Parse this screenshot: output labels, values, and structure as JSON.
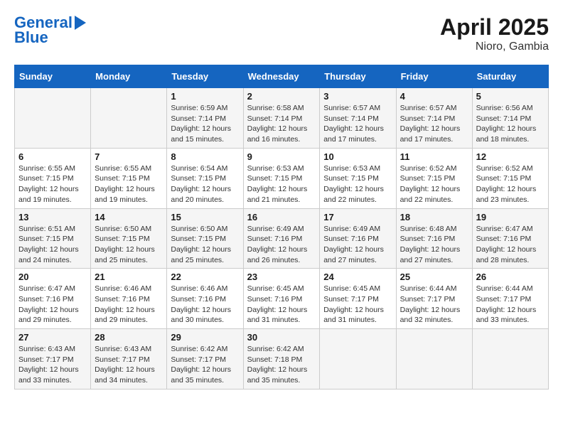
{
  "header": {
    "logo_line1": "General",
    "logo_line2": "Blue",
    "title": "April 2025",
    "subtitle": "Nioro, Gambia"
  },
  "days_of_week": [
    "Sunday",
    "Monday",
    "Tuesday",
    "Wednesday",
    "Thursday",
    "Friday",
    "Saturday"
  ],
  "weeks": [
    [
      {
        "day": "",
        "info": ""
      },
      {
        "day": "",
        "info": ""
      },
      {
        "day": "1",
        "info": "Sunrise: 6:59 AM\nSunset: 7:14 PM\nDaylight: 12 hours and 15 minutes."
      },
      {
        "day": "2",
        "info": "Sunrise: 6:58 AM\nSunset: 7:14 PM\nDaylight: 12 hours and 16 minutes."
      },
      {
        "day": "3",
        "info": "Sunrise: 6:57 AM\nSunset: 7:14 PM\nDaylight: 12 hours and 17 minutes."
      },
      {
        "day": "4",
        "info": "Sunrise: 6:57 AM\nSunset: 7:14 PM\nDaylight: 12 hours and 17 minutes."
      },
      {
        "day": "5",
        "info": "Sunrise: 6:56 AM\nSunset: 7:14 PM\nDaylight: 12 hours and 18 minutes."
      }
    ],
    [
      {
        "day": "6",
        "info": "Sunrise: 6:55 AM\nSunset: 7:15 PM\nDaylight: 12 hours and 19 minutes."
      },
      {
        "day": "7",
        "info": "Sunrise: 6:55 AM\nSunset: 7:15 PM\nDaylight: 12 hours and 19 minutes."
      },
      {
        "day": "8",
        "info": "Sunrise: 6:54 AM\nSunset: 7:15 PM\nDaylight: 12 hours and 20 minutes."
      },
      {
        "day": "9",
        "info": "Sunrise: 6:53 AM\nSunset: 7:15 PM\nDaylight: 12 hours and 21 minutes."
      },
      {
        "day": "10",
        "info": "Sunrise: 6:53 AM\nSunset: 7:15 PM\nDaylight: 12 hours and 22 minutes."
      },
      {
        "day": "11",
        "info": "Sunrise: 6:52 AM\nSunset: 7:15 PM\nDaylight: 12 hours and 22 minutes."
      },
      {
        "day": "12",
        "info": "Sunrise: 6:52 AM\nSunset: 7:15 PM\nDaylight: 12 hours and 23 minutes."
      }
    ],
    [
      {
        "day": "13",
        "info": "Sunrise: 6:51 AM\nSunset: 7:15 PM\nDaylight: 12 hours and 24 minutes."
      },
      {
        "day": "14",
        "info": "Sunrise: 6:50 AM\nSunset: 7:15 PM\nDaylight: 12 hours and 25 minutes."
      },
      {
        "day": "15",
        "info": "Sunrise: 6:50 AM\nSunset: 7:15 PM\nDaylight: 12 hours and 25 minutes."
      },
      {
        "day": "16",
        "info": "Sunrise: 6:49 AM\nSunset: 7:16 PM\nDaylight: 12 hours and 26 minutes."
      },
      {
        "day": "17",
        "info": "Sunrise: 6:49 AM\nSunset: 7:16 PM\nDaylight: 12 hours and 27 minutes."
      },
      {
        "day": "18",
        "info": "Sunrise: 6:48 AM\nSunset: 7:16 PM\nDaylight: 12 hours and 27 minutes."
      },
      {
        "day": "19",
        "info": "Sunrise: 6:47 AM\nSunset: 7:16 PM\nDaylight: 12 hours and 28 minutes."
      }
    ],
    [
      {
        "day": "20",
        "info": "Sunrise: 6:47 AM\nSunset: 7:16 PM\nDaylight: 12 hours and 29 minutes."
      },
      {
        "day": "21",
        "info": "Sunrise: 6:46 AM\nSunset: 7:16 PM\nDaylight: 12 hours and 29 minutes."
      },
      {
        "day": "22",
        "info": "Sunrise: 6:46 AM\nSunset: 7:16 PM\nDaylight: 12 hours and 30 minutes."
      },
      {
        "day": "23",
        "info": "Sunrise: 6:45 AM\nSunset: 7:16 PM\nDaylight: 12 hours and 31 minutes."
      },
      {
        "day": "24",
        "info": "Sunrise: 6:45 AM\nSunset: 7:17 PM\nDaylight: 12 hours and 31 minutes."
      },
      {
        "day": "25",
        "info": "Sunrise: 6:44 AM\nSunset: 7:17 PM\nDaylight: 12 hours and 32 minutes."
      },
      {
        "day": "26",
        "info": "Sunrise: 6:44 AM\nSunset: 7:17 PM\nDaylight: 12 hours and 33 minutes."
      }
    ],
    [
      {
        "day": "27",
        "info": "Sunrise: 6:43 AM\nSunset: 7:17 PM\nDaylight: 12 hours and 33 minutes."
      },
      {
        "day": "28",
        "info": "Sunrise: 6:43 AM\nSunset: 7:17 PM\nDaylight: 12 hours and 34 minutes."
      },
      {
        "day": "29",
        "info": "Sunrise: 6:42 AM\nSunset: 7:17 PM\nDaylight: 12 hours and 35 minutes."
      },
      {
        "day": "30",
        "info": "Sunrise: 6:42 AM\nSunset: 7:18 PM\nDaylight: 12 hours and 35 minutes."
      },
      {
        "day": "",
        "info": ""
      },
      {
        "day": "",
        "info": ""
      },
      {
        "day": "",
        "info": ""
      }
    ]
  ]
}
